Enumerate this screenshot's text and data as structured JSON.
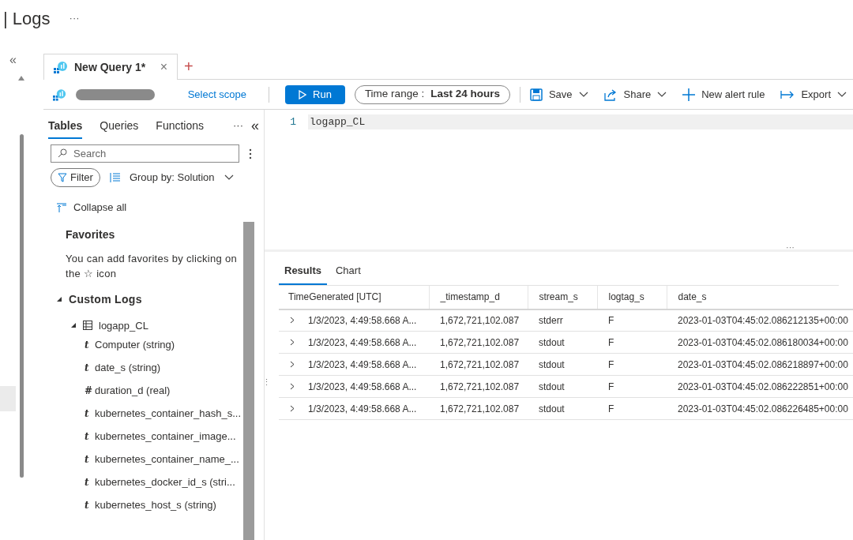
{
  "header": {
    "title": "| Logs",
    "more": "···"
  },
  "query_tabs": [
    {
      "label": "New Query 1*",
      "selected": true,
      "close": "×"
    }
  ],
  "new_tab": "+",
  "toolbar": {
    "scope_link": "Select scope",
    "run": "Run",
    "time_range_label": "Time range :",
    "time_range_value": "Last 24 hours",
    "actions": [
      {
        "label": "Save",
        "kind": "save",
        "dropdown": true
      },
      {
        "label": "Share",
        "kind": "share",
        "dropdown": true
      },
      {
        "label": "New alert rule",
        "kind": "alert",
        "dropdown": false
      },
      {
        "label": "Export",
        "kind": "export",
        "dropdown": true
      }
    ]
  },
  "side_tabs": [
    {
      "label": "Tables",
      "selected": true
    },
    {
      "label": "Queries",
      "selected": false
    },
    {
      "label": "Functions",
      "selected": false
    }
  ],
  "side_more": "···",
  "collapse_panel": "«",
  "outer_collapse": "«",
  "search": {
    "placeholder": "Search"
  },
  "filter": "Filter",
  "group_by": "Group by: Solution",
  "collapse_all": "Collapse all",
  "favorites": {
    "title": "Favorites",
    "hint_before": "You can add favorites by clicking on the",
    "star": "☆",
    "hint_after": "icon"
  },
  "tree": [
    {
      "label": "Custom Logs",
      "expanded": true,
      "children": [
        {
          "label": "logapp_CL",
          "expanded": true,
          "children": [
            {
              "type": "t",
              "label": "Computer (string)"
            },
            {
              "type": "t",
              "label": "date_s (string)"
            },
            {
              "type": "#",
              "label": "duration_d (real)"
            },
            {
              "type": "t",
              "label": "kubernetes_container_hash_s..."
            },
            {
              "type": "t",
              "label": "kubernetes_container_image..."
            },
            {
              "type": "t",
              "label": "kubernetes_container_name_..."
            },
            {
              "type": "t",
              "label": "kubernetes_docker_id_s (stri..."
            },
            {
              "type": "t",
              "label": "kubernetes_host_s (string)"
            }
          ]
        }
      ]
    }
  ],
  "editor": {
    "lines": [
      {
        "number": "1",
        "code": "logapp_CL"
      }
    ]
  },
  "splitter": "···",
  "resize_handle": "⋮",
  "result_tabs": [
    {
      "label": "Results",
      "selected": true
    },
    {
      "label": "Chart",
      "selected": false
    }
  ],
  "table": {
    "columns": [
      "TimeGenerated [UTC]",
      "_timestamp_d",
      "stream_s",
      "logtag_s",
      "date_s"
    ],
    "rows": [
      [
        "1/3/2023, 4:49:58.668 A...",
        "1,672,721,102.087",
        "stderr",
        "F",
        "2023-01-03T04:45:02.086212135+00:00"
      ],
      [
        "1/3/2023, 4:49:58.668 A...",
        "1,672,721,102.087",
        "stdout",
        "F",
        "2023-01-03T04:45:02.086180034+00:00"
      ],
      [
        "1/3/2023, 4:49:58.668 A...",
        "1,672,721,102.087",
        "stdout",
        "F",
        "2023-01-03T04:45:02.086218897+00:00"
      ],
      [
        "1/3/2023, 4:49:58.668 A...",
        "1,672,721,102.087",
        "stdout",
        "F",
        "2023-01-03T04:45:02.086222851+00:00"
      ],
      [
        "1/3/2023, 4:49:58.668 A...",
        "1,672,721,102.087",
        "stdout",
        "F",
        "2023-01-03T04:45:02.086226485+00:00"
      ]
    ]
  }
}
